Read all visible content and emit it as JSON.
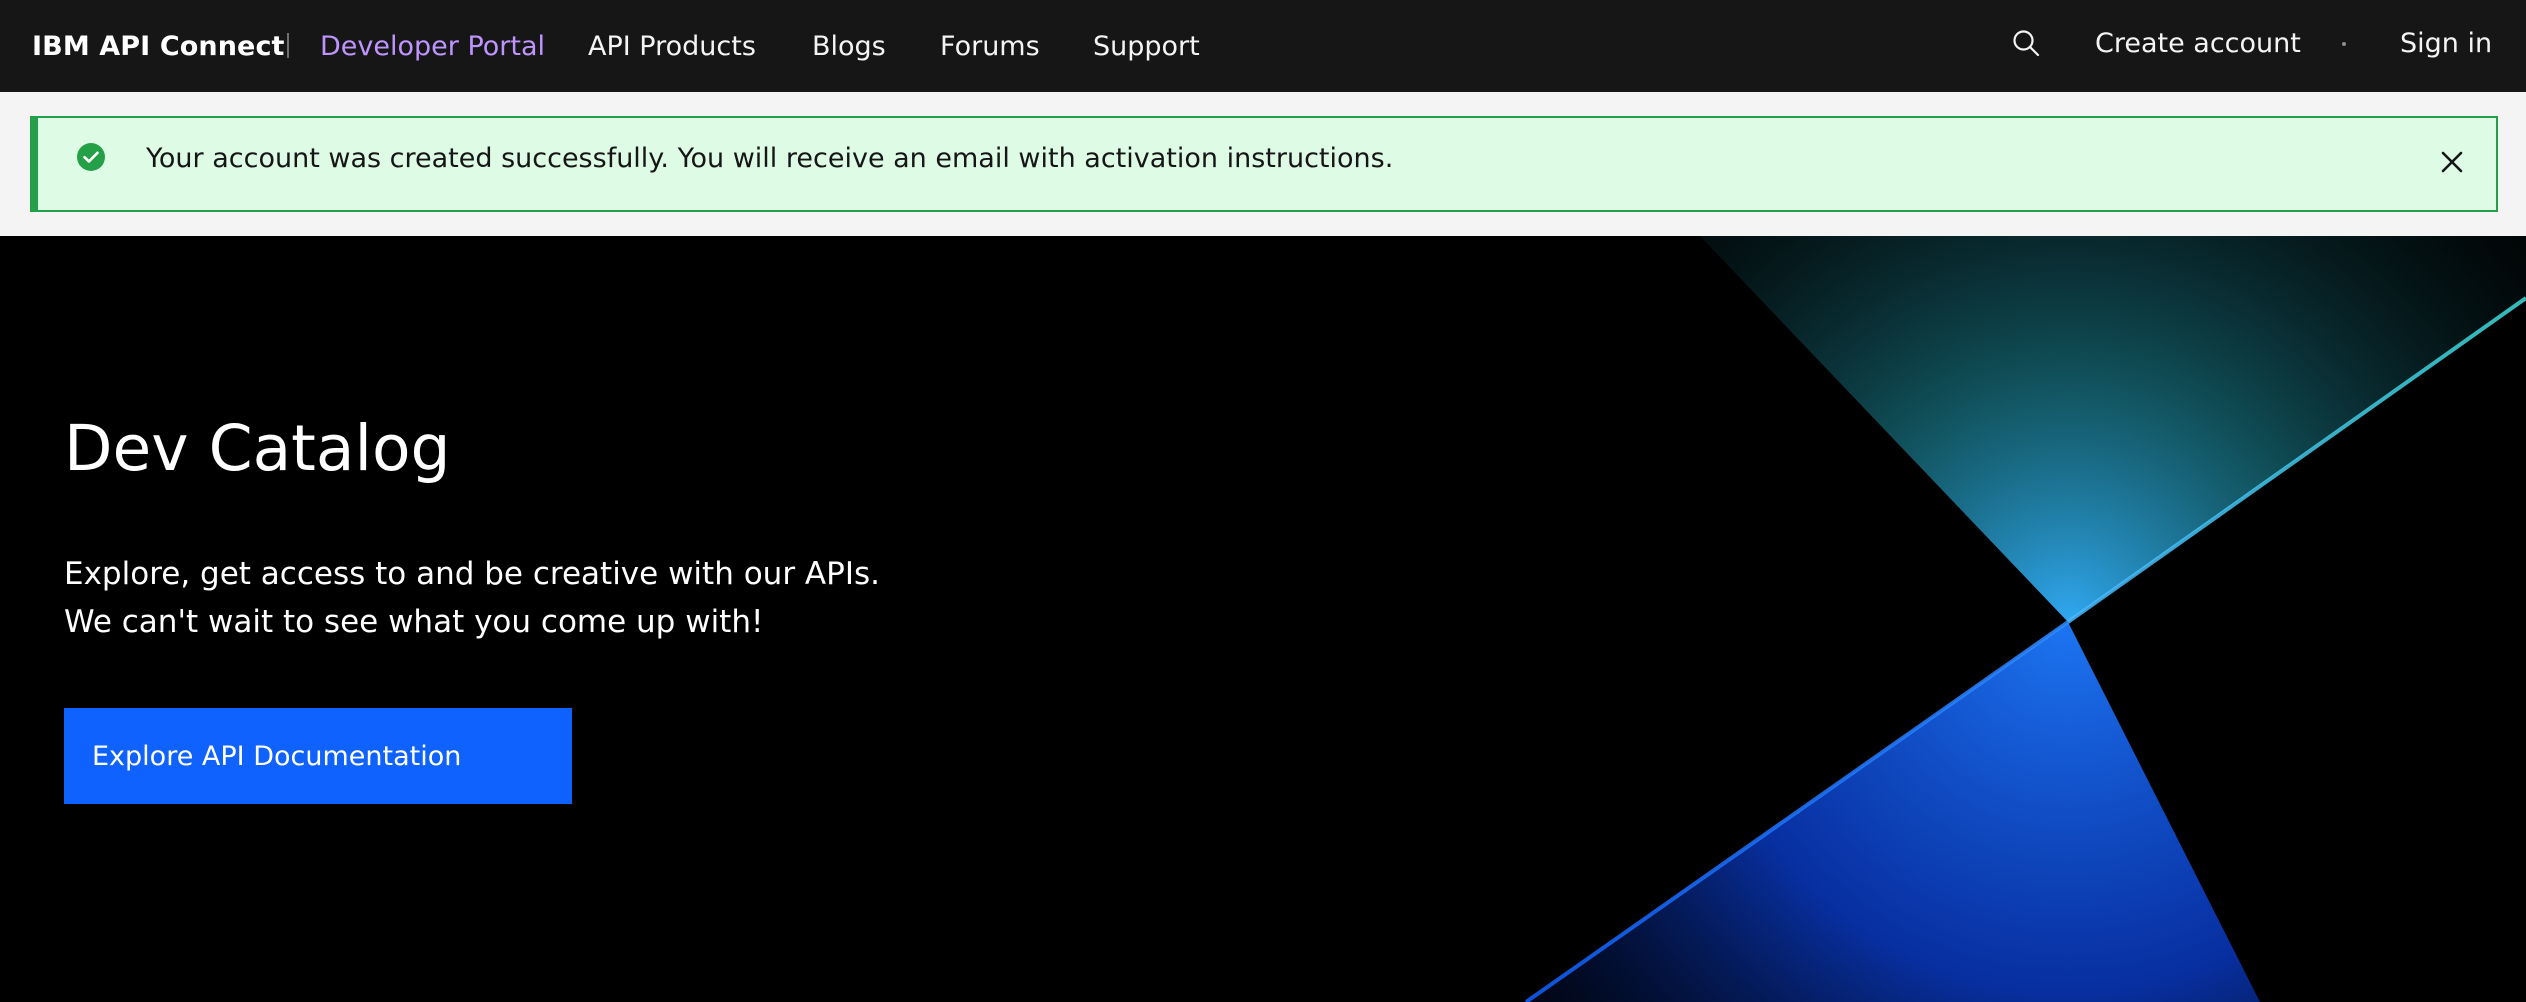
{
  "header": {
    "brand": "IBM API Connect",
    "nav_links": [
      {
        "label": "Developer Portal",
        "active": true
      },
      {
        "label": "API Products",
        "active": false
      },
      {
        "label": "Blogs",
        "active": false
      },
      {
        "label": "Forums",
        "active": false
      },
      {
        "label": "Support",
        "active": false
      }
    ],
    "search_icon": "search-icon",
    "create_account_label": "Create account",
    "sign_in_label": "Sign in"
  },
  "notification": {
    "kind": "success",
    "icon": "checkmark-filled-icon",
    "message": "Your account was created successfully. You will receive an email with activation instructions.",
    "close_icon": "close-icon"
  },
  "hero": {
    "title": "Dev Catalog",
    "description_line1": "Explore, get access to and be creative with our APIs.",
    "description_line2": "We can't wait to see what you come up with!",
    "cta_label": "Explore API Documentation"
  },
  "colors": {
    "nav_bg": "#161616",
    "active_link": "#be95ff",
    "success_bg": "#defbe6",
    "success_accent": "#24a148",
    "hero_bg": "#000000",
    "cta_bg": "#0f62fe",
    "art_cyan": "#3ddbd9",
    "art_blue": "#0f62fe"
  }
}
